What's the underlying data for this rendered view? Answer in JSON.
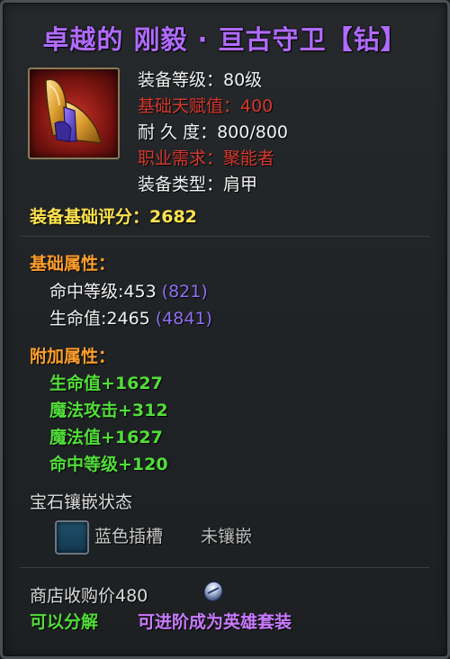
{
  "item": {
    "title": "卓越的 刚毅 · 亘古守卫【钻】",
    "icon": "shoulder-armor-icon"
  },
  "stats": [
    {
      "text": "装备等级：80级",
      "color": "white"
    },
    {
      "text": "基础天赋值：400",
      "color": "red"
    },
    {
      "text": "耐 久 度：800/800",
      "color": "white"
    },
    {
      "text": "职业需求：聚能者",
      "color": "red"
    },
    {
      "text": "装备类型：肩甲",
      "color": "white"
    }
  ],
  "score": "装备基础评分：2682",
  "base_attributes": {
    "header": "基础属性：",
    "items": [
      {
        "name": "命中等级:453",
        "extra": "(821)"
      },
      {
        "name": "生命值:2465",
        "extra": "(4841)"
      }
    ]
  },
  "bonus_attributes": {
    "header": "附加属性：",
    "items": [
      "生命值+1627",
      "魔法攻击+312",
      "魔法值+1627",
      "命中等级+120"
    ]
  },
  "gem": {
    "header": "宝石镶嵌状态",
    "slot_label": "蓝色插槽",
    "slot_status": "未镶嵌"
  },
  "shop": {
    "price": "商店收购价480",
    "coin_icon": "coin-icon"
  },
  "footer": {
    "left": "可以分解",
    "right": "可进阶成为英雄套装"
  },
  "colors": {
    "title": "#b06bff",
    "red_text": "#d6392e",
    "score": "#ffe34f",
    "section_header": "#ff9e2c",
    "green": "#52dd3a",
    "purple_extra": "#8e6ff0"
  }
}
